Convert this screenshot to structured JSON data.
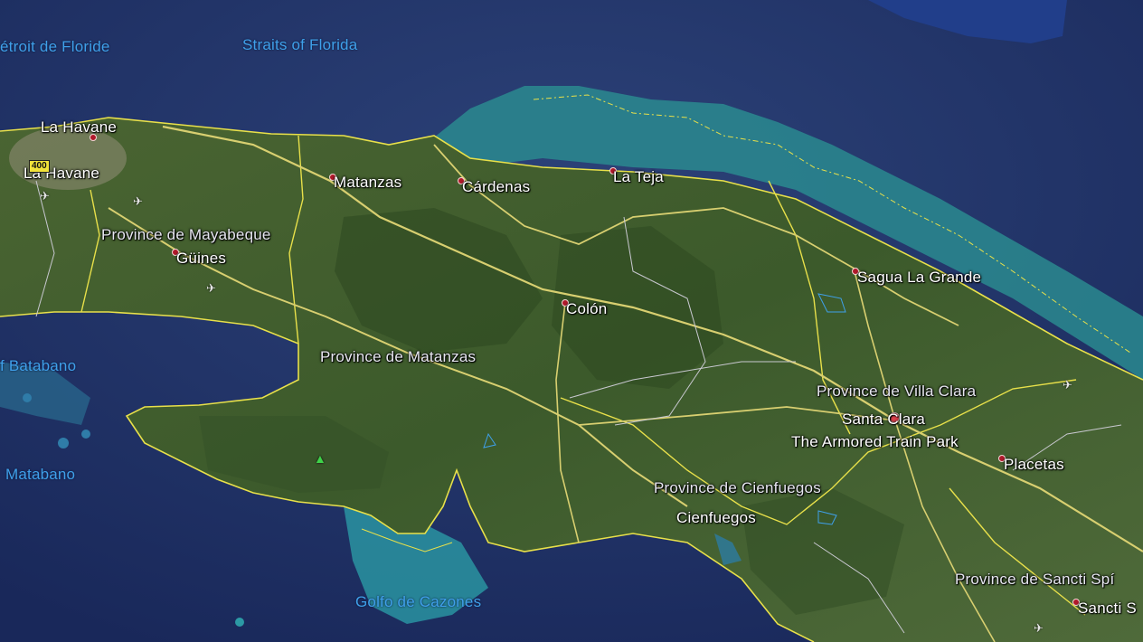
{
  "map": {
    "water_labels": [
      {
        "name": "label-detroit-de-floride",
        "text": "étroit de Floride"
      },
      {
        "name": "label-straits-of-florida",
        "text": "Straits of Florida"
      },
      {
        "name": "label-golfe-de-batabano",
        "text": "f Batabano"
      },
      {
        "name": "label-golfe-de-matabano",
        "text": "Matabano"
      },
      {
        "name": "label-golfo-de-cazones",
        "text": "Golfo de Cazones"
      }
    ],
    "places": [
      {
        "name": "label-la-havane-1",
        "text": "La Havane"
      },
      {
        "name": "label-la-havane-2",
        "text": "La Havane"
      },
      {
        "name": "label-matanzas",
        "text": "Matanzas"
      },
      {
        "name": "label-cardenas",
        "text": "Cárdenas"
      },
      {
        "name": "label-la-teja",
        "text": "La Teja"
      },
      {
        "name": "label-guines",
        "text": "Güines"
      },
      {
        "name": "label-colon",
        "text": "Colón"
      },
      {
        "name": "label-sagua-la-grande",
        "text": "Sagua La Grande"
      },
      {
        "name": "label-santa-clara",
        "text": "Santa Clara"
      },
      {
        "name": "label-armored-train-park",
        "text": "The Armored Train Park"
      },
      {
        "name": "label-placetas",
        "text": "Placetas"
      },
      {
        "name": "label-cienfuegos",
        "text": "Cienfuegos"
      },
      {
        "name": "label-sancti-spiritus",
        "text": "Sancti S"
      }
    ],
    "regions": [
      {
        "name": "label-province-mayabeque",
        "text": "Province de Mayabeque"
      },
      {
        "name": "label-province-matanzas",
        "text": "Province de Matanzas"
      },
      {
        "name": "label-province-villa-clara",
        "text": "Province de Villa Clara"
      },
      {
        "name": "label-province-cienfuegos",
        "text": "Province de Cienfuegos"
      },
      {
        "name": "label-province-sancti-spiritus",
        "text": "Province de Sancti Spí"
      }
    ],
    "road_shield": "400",
    "icons": {
      "airport": "airplane-icon",
      "park": "tree-icon",
      "city": "city-dot-icon"
    },
    "colors": {
      "ocean_deep": "#1b2f63",
      "ocean_shallow": "#2a8a8f",
      "land": "#3f5a2c",
      "border": "#e8e04a",
      "road": "#c9c1a0",
      "water_label": "#3fa0ea"
    }
  }
}
